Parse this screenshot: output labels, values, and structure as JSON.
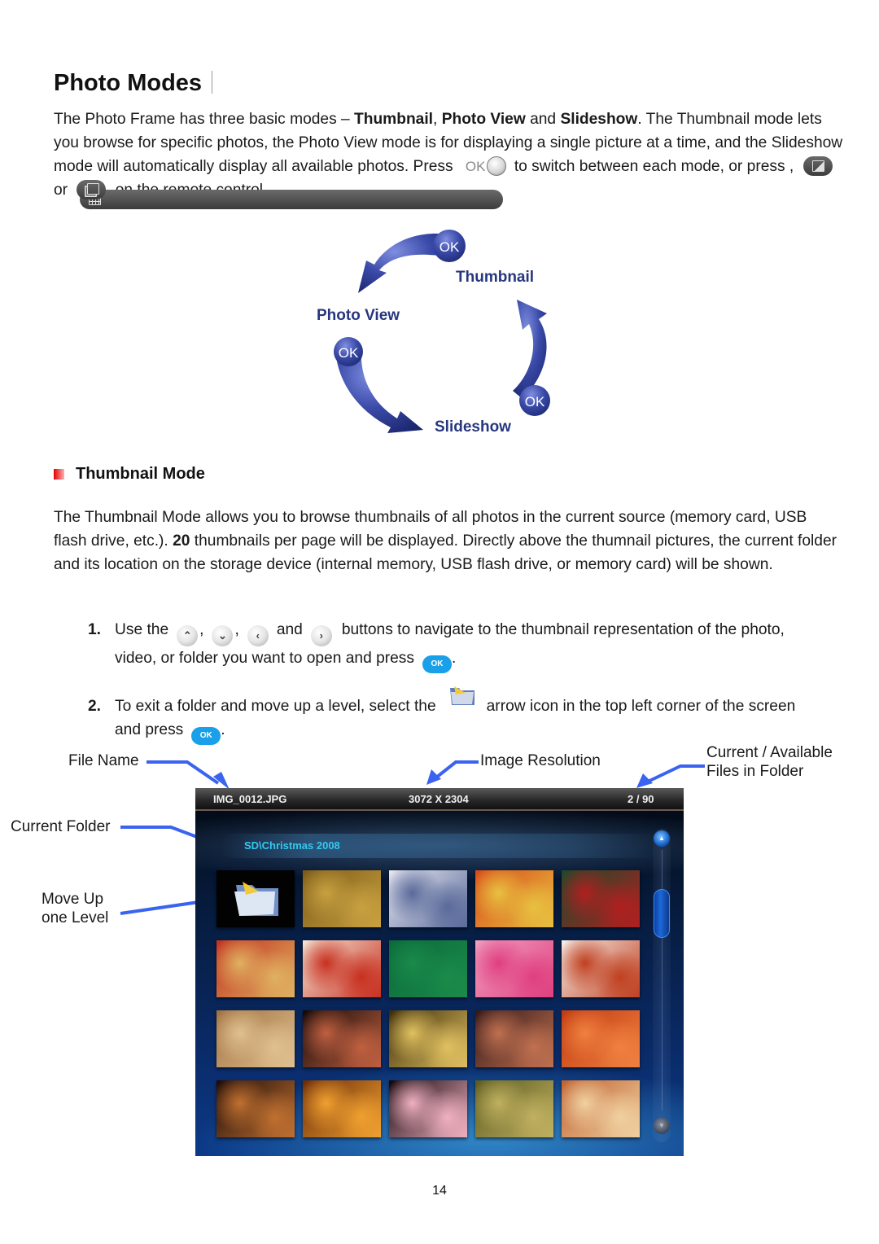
{
  "page": {
    "title": "Photo Modes",
    "page_number": "14"
  },
  "intro": {
    "t1": "The Photo Frame has three basic modes – ",
    "b1": "Thumbnail",
    "t2": ", ",
    "b2": "Photo View",
    "t3": " and ",
    "b3": "Slideshow",
    "t4": ". The Thumbnail mode lets you browse for specific photos, the Photo View mode is for displaying a single picture at a time, and the Slideshow mode will automatically display all available photos. Press ",
    "ok_label": "OK",
    "t5": " to switch between each mode, or press ",
    "t6": ", ",
    "t7": " or ",
    "t8": " on the remote control."
  },
  "cycle_diagram": {
    "modes": [
      "Thumbnail",
      "Photo View",
      "Slideshow"
    ],
    "ok_labels": [
      "OK",
      "OK",
      "OK"
    ],
    "color": "#27377f"
  },
  "thumbnail_section": {
    "heading": "Thumbnail Mode",
    "d1": "The Thumbnail Mode allows you to browse thumbnails of all photos in the current source (memory card, USB flash drive, etc.). ",
    "d_bold": "20",
    "d2": " thumbnails per page will be displayed. Directly above the thumnail pictures, the current folder and its location on the storage device (internal memory, USB flash drive, or memory card) will be shown."
  },
  "steps": [
    {
      "num": "1.",
      "a": "Use the",
      "sep1": ",",
      "sep2": ",",
      "and": "and",
      "b": "buttons to navigate to the thumbnail representation of the photo,",
      "c": "video, or folder you want to open and press",
      "end": ".",
      "nav_icons": [
        "up-arrow",
        "down-arrow",
        "left-arrow",
        "right-arrow"
      ],
      "ok_label": "OK"
    },
    {
      "num": "2.",
      "a": "To exit a folder and move up a level, select the",
      "b": "arrow icon in the top left corner of the screen",
      "c": "and press",
      "end": ".",
      "ok_label": "OK"
    }
  ],
  "callouts": {
    "file_name": "File Name",
    "image_resolution": "Image Resolution",
    "current_available_1": "Current / Available",
    "current_available_2": "Files in Folder",
    "current_folder": "Current Folder",
    "move_up_1": "Move Up",
    "move_up_2": "one Level",
    "arrow_color": "#3a63f0"
  },
  "screen": {
    "file_name": "IMG_0012.JPG",
    "resolution": "3072 X 2304",
    "counter": "2 / 90",
    "folder_path": "SD\\Christmas 2008",
    "scroll_position": 0.1,
    "thumbnails": [
      {
        "kind": "folder-up",
        "colors": [
          "#020202",
          "#020202"
        ]
      },
      {
        "kind": "photo",
        "colors": [
          "#7a5a18",
          "#c8a040"
        ]
      },
      {
        "kind": "photo",
        "colors": [
          "#e8e8f0",
          "#5a6a9a"
        ]
      },
      {
        "kind": "photo",
        "colors": [
          "#d84a1a",
          "#e8c040"
        ]
      },
      {
        "kind": "photo",
        "colors": [
          "#1a4a2a",
          "#b02020"
        ]
      },
      {
        "kind": "photo",
        "colors": [
          "#c03020",
          "#e0b060"
        ]
      },
      {
        "kind": "photo",
        "colors": [
          "#f4e8d8",
          "#c83020"
        ]
      },
      {
        "kind": "photo",
        "colors": [
          "#0a6a3a",
          "#1a8a4a"
        ]
      },
      {
        "kind": "photo",
        "colors": [
          "#f0a0c0",
          "#e04080"
        ]
      },
      {
        "kind": "photo",
        "colors": [
          "#f6f0ea",
          "#c04020"
        ]
      },
      {
        "kind": "photo",
        "colors": [
          "#a07040",
          "#e0c090"
        ]
      },
      {
        "kind": "photo",
        "colors": [
          "#100808",
          "#c06040"
        ]
      },
      {
        "kind": "photo",
        "colors": [
          "#3a2a08",
          "#e0c060"
        ]
      },
      {
        "kind": "photo",
        "colors": [
          "#301818",
          "#c07050"
        ]
      },
      {
        "kind": "photo",
        "colors": [
          "#c03a10",
          "#f08040"
        ]
      },
      {
        "kind": "photo",
        "colors": [
          "#1a0a08",
          "#c07030"
        ]
      },
      {
        "kind": "photo",
        "colors": [
          "#6a2a08",
          "#f0a030"
        ]
      },
      {
        "kind": "photo",
        "colors": [
          "#100408",
          "#f0b0c0"
        ]
      },
      {
        "kind": "photo",
        "colors": [
          "#5a5a20",
          "#c0b060"
        ]
      },
      {
        "kind": "photo",
        "colors": [
          "#c06030",
          "#f0d0a0"
        ]
      }
    ]
  }
}
